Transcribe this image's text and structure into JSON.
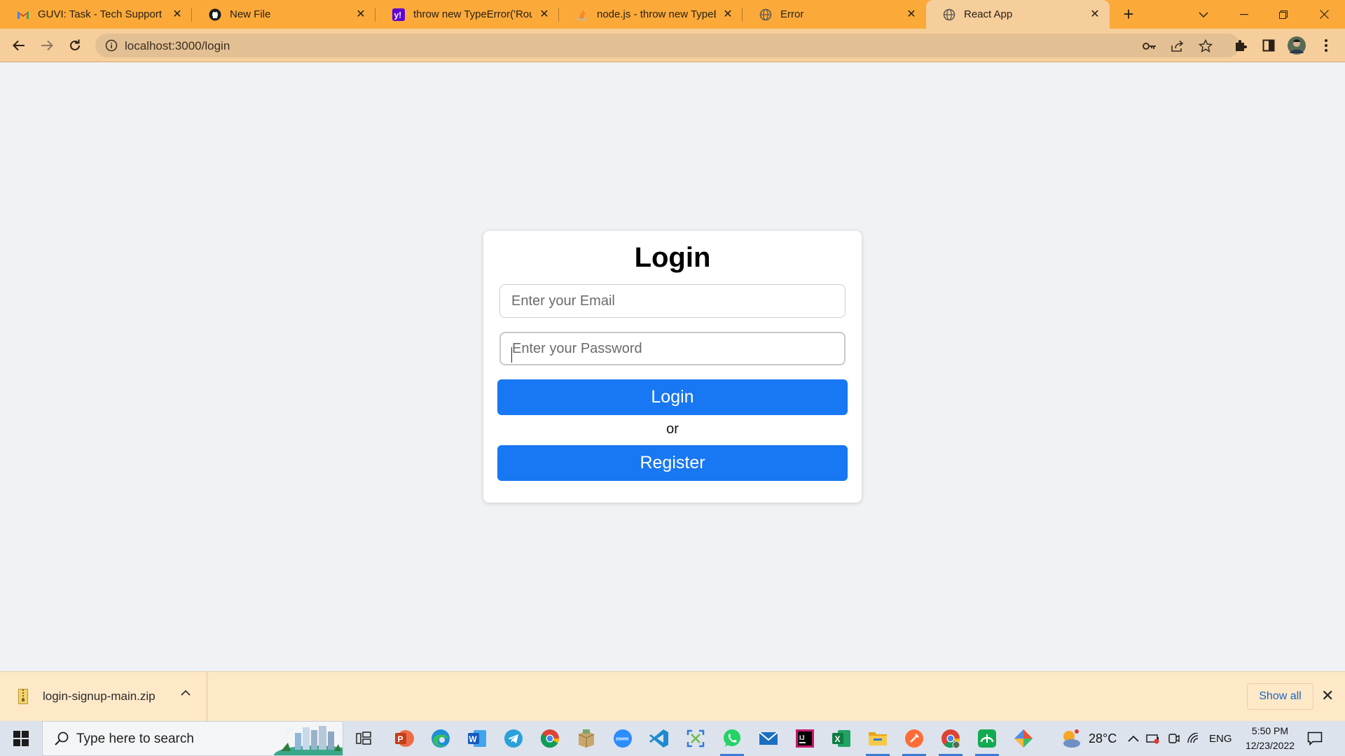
{
  "browser": {
    "tabs": [
      {
        "title": "GUVI: Task - Tech Support Ir",
        "icon": "gmail-icon",
        "active": false
      },
      {
        "title": "New File",
        "icon": "github-icon",
        "active": false
      },
      {
        "title": "throw new TypeError('Route",
        "icon": "yahoo-icon",
        "active": false
      },
      {
        "title": "node.js - throw new TypeErr",
        "icon": "stackoverflow-icon",
        "active": false
      },
      {
        "title": "Error",
        "icon": "globe-icon",
        "active": false
      },
      {
        "title": "React App",
        "icon": "globe-icon",
        "active": true
      }
    ],
    "tab_close_symbol": "✕",
    "new_tab_symbol": "+",
    "url": "localhost:3000/login",
    "accent_color": "#fbaa3a"
  },
  "page": {
    "heading": "Login",
    "email_placeholder": "Enter your Email",
    "password_placeholder": "Enter your Password",
    "login_button": "Login",
    "or_text": "or",
    "register_button": "Register",
    "button_color": "#1877f2",
    "background_color": "#f0f2f5"
  },
  "download_shelf": {
    "filename": "login-signup-main.zip",
    "show_all": "Show all",
    "close_symbol": "✕"
  },
  "taskbar": {
    "search_placeholder": "Type here to search",
    "apps": [
      "task-view-icon",
      "powerpoint-icon",
      "edge-icon",
      "word-icon",
      "telegram-icon",
      "chrome-icon",
      "archive-icon",
      "zoom-icon",
      "vscode-icon",
      "snip-icon",
      "whatsapp-icon",
      "mail-icon",
      "intellij-icon",
      "excel-icon",
      "file-explorer-icon",
      "postman-icon",
      "chrome-profile-icon",
      "mongodb-compass-icon",
      "git-icon"
    ],
    "weather": "28°C",
    "language": "ENG",
    "time": "5:50 PM",
    "date": "12/23/2022"
  }
}
